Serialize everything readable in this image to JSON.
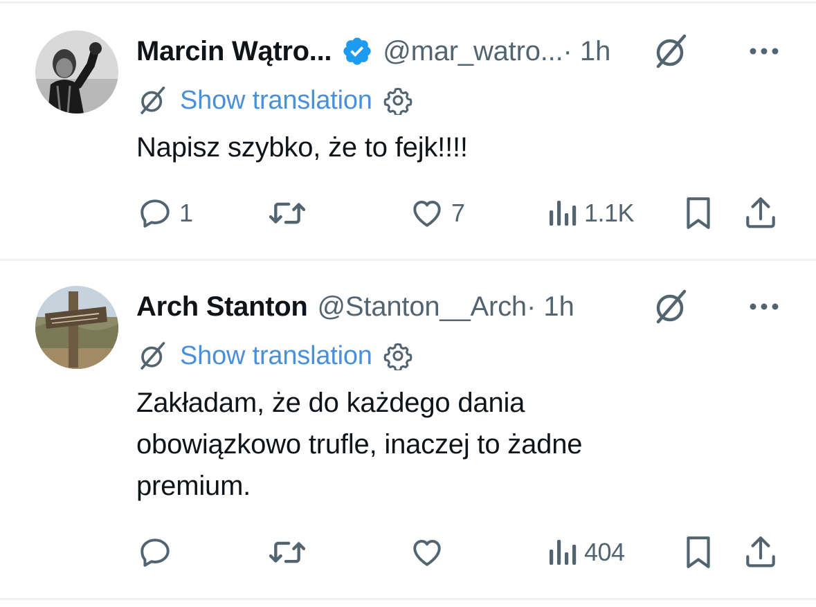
{
  "tweets": [
    {
      "name": "Marcin Wątro...",
      "handle": "@mar_watro...",
      "time": " · 1h",
      "verified": true,
      "translate_label": "Show translation",
      "text": "Napisz szybko, że to fejk!!!!",
      "stats": {
        "replies": "1",
        "retweets": "",
        "likes": "7",
        "views": "1.1K"
      }
    },
    {
      "name": "Arch Stanton",
      "handle": "@Stanton__Arch",
      "time": " · 1h",
      "verified": false,
      "translate_label": "Show translation",
      "text": "Zakładam, że do każdego dania obowiązkowo trufle, inaczej to żadne premium.",
      "stats": {
        "replies": "",
        "retweets": "",
        "likes": "",
        "views": "404"
      }
    }
  ],
  "icons": {
    "reply": "reply-icon",
    "retweet": "retweet-icon",
    "like": "heart-icon",
    "views": "views-icon",
    "bookmark": "bookmark-icon",
    "share": "share-icon",
    "grok": "grok-icon",
    "more": "more-icon",
    "gear": "gear-icon",
    "verified": "verified-badge-icon"
  },
  "colors": {
    "text": "#0f1419",
    "muted": "#536471",
    "link": "#4a90d9",
    "verified": "#1d9bf0",
    "divider": "#eff3f4"
  }
}
